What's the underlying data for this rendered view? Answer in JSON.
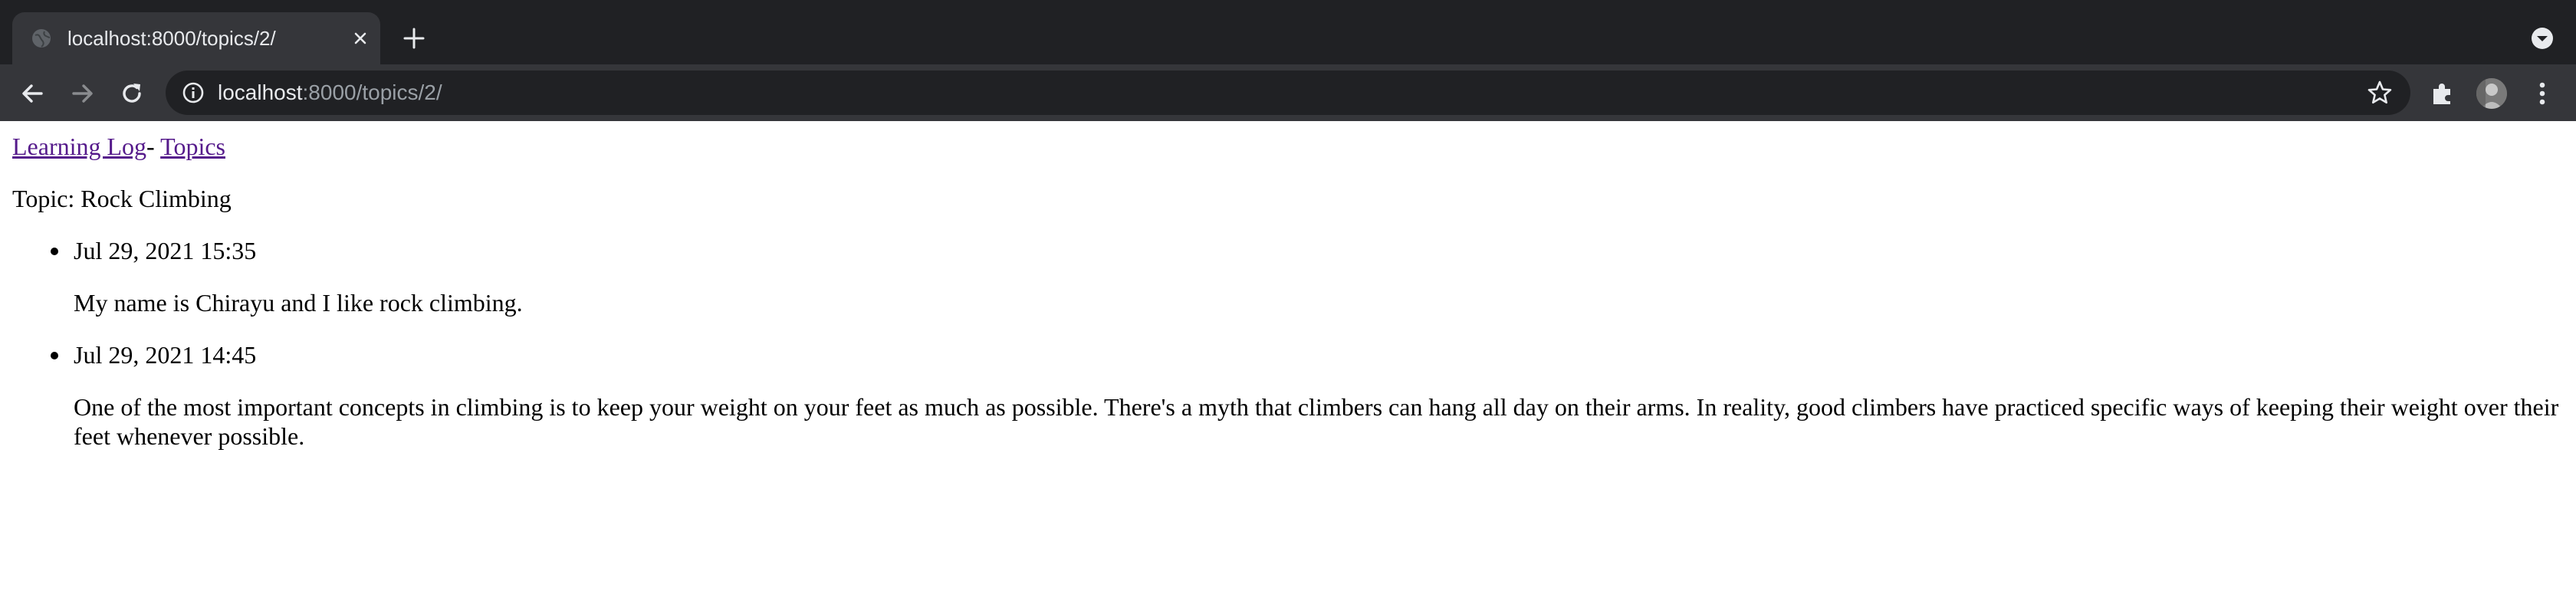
{
  "browser": {
    "tab_title": "localhost:8000/topics/2/",
    "url_host": "localhost",
    "url_rest": ":8000/topics/2/"
  },
  "page": {
    "nav_home": "Learning Log",
    "nav_separator": "- ",
    "nav_topics": "Topics",
    "topic_title": "Topic: Rock Climbing",
    "entries": [
      {
        "date": "Jul 29, 2021 15:35",
        "text": "My name is Chirayu and I like rock climbing."
      },
      {
        "date": "Jul 29, 2021 14:45",
        "text": "One of the most important concepts in climbing is to keep your weight on your feet as much as possible. There's a myth that climbers can hang all day on their arms. In reality, good climbers have practiced specific ways of keeping their weight over their feet whenever possible."
      }
    ]
  }
}
